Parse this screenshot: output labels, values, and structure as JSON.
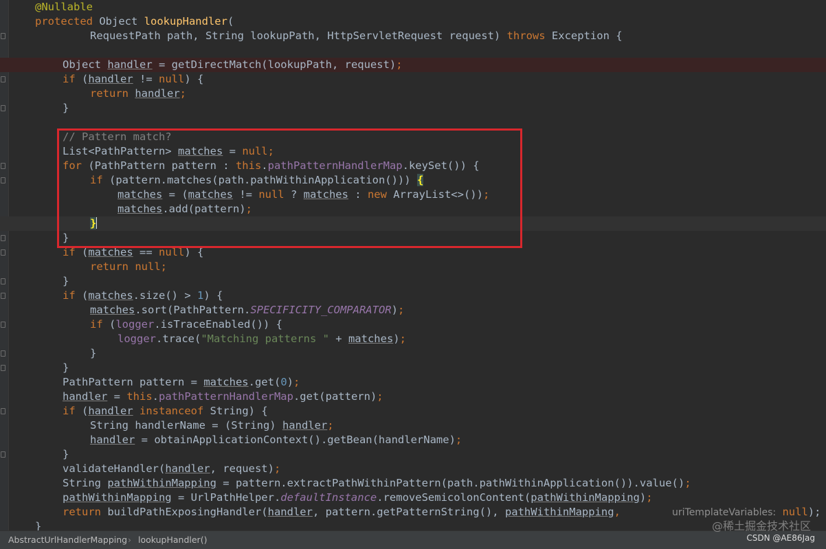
{
  "editor": {
    "lines": {
      "l0": {
        "a": "@Nullable"
      },
      "l1": {
        "kw": "protected",
        "a": " Object ",
        "fn": "lookupHandler",
        "b": "("
      },
      "l2": {
        "a": "RequestPath path, String lookupPath, HttpServletRequest request) ",
        "kw": "throws",
        "b": " Exception {"
      },
      "l4": {
        "a": "Object ",
        "u1": "handler",
        "b": " = getDirectMatch(lookupPath, request)",
        "c": ";"
      },
      "l5": {
        "kw": "if",
        "a": " (",
        "u1": "handler",
        "b": " != ",
        "kw2": "null",
        "c": ") {"
      },
      "l6": {
        "kw": "return",
        "a": " ",
        "u1": "handler",
        "b": ";"
      },
      "l7": {
        "a": "}"
      },
      "l9": {
        "cmt": "// Pattern match?"
      },
      "l10": {
        "a": "List<PathPattern> ",
        "u1": "matches",
        "b": " = ",
        "kw": "null",
        "c": ";"
      },
      "l11": {
        "kw": "for",
        "a": " (PathPattern pattern : ",
        "kw2": "this",
        "b": ".",
        "fld": "pathPatternHandlerMap",
        "c": ".keySet()) {"
      },
      "l12": {
        "kw": "if",
        "a": " (pattern.matches(path.pathWithinApplication())) ",
        "br": "{"
      },
      "l13": {
        "u1": "matches",
        "a": " = (",
        "u2": "matches",
        "b": " != ",
        "kw": "null",
        "c": " ? ",
        "u3": "matches",
        "d": " : ",
        "kw2": "new",
        "e": " ArrayList<>())",
        "f": ";"
      },
      "l14": {
        "u1": "matches",
        "a": ".add(pattern)",
        "b": ";"
      },
      "l15": {
        "br": "}"
      },
      "l16": {
        "a": "}"
      },
      "l17": {
        "kw": "if",
        "a": " (",
        "u1": "matches",
        "b": " == ",
        "kw2": "null",
        "c": ") {"
      },
      "l18": {
        "kw": "return",
        "a": " ",
        "kw2": "null",
        "b": ";"
      },
      "l19": {
        "a": "}"
      },
      "l20": {
        "kw": "if",
        "a": " (",
        "u1": "matches",
        "b": ".size() > ",
        "num": "1",
        "c": ") {"
      },
      "l21": {
        "u1": "matches",
        "a": ".sort(PathPattern.",
        "sf": "SPECIFICITY_COMPARATOR",
        "b": ")",
        "c": ";"
      },
      "l22": {
        "kw": "if",
        "a": " (",
        "fld": "logger",
        "b": ".isTraceEnabled()) {"
      },
      "l23": {
        "fld": "logger",
        "a": ".trace(",
        "str": "\"Matching patterns \"",
        "b": " + ",
        "u1": "matches",
        "c": ")",
        "d": ";"
      },
      "l24": {
        "a": "}"
      },
      "l25": {
        "a": "}"
      },
      "l26": {
        "a": "PathPattern pattern = ",
        "u1": "matches",
        "b": ".get(",
        "num": "0",
        "c": ")",
        "d": ";"
      },
      "l27": {
        "u1": "handler",
        "a": " = ",
        "kw": "this",
        "b": ".",
        "fld": "pathPatternHandlerMap",
        "c": ".get(pattern)",
        "d": ";"
      },
      "l28": {
        "kw": "if",
        "a": " (",
        "u1": "handler",
        "b": " ",
        "kw2": "instanceof",
        "c": " String) {"
      },
      "l29": {
        "a": "String handlerName = (String) ",
        "u1": "handler",
        "b": ";"
      },
      "l30": {
        "u1": "handler",
        "a": " = obtainApplicationContext().getBean(handlerName)",
        "b": ";"
      },
      "l31": {
        "a": "}"
      },
      "l32": {
        "a": "validateHandler(",
        "u1": "handler",
        "b": ", request)",
        "c": ";"
      },
      "l33": {
        "a": "String ",
        "u1": "pathWithinMapping",
        "b": " = pattern.extractPathWithinPattern(path.pathWithinApplication()).value()",
        "c": ";"
      },
      "l34": {
        "u1": "pathWithinMapping",
        "a": " = UrlPathHelper.",
        "sf": "defaultInstance",
        "b": ".removeSemicolonContent(",
        "u2": "pathWithinMapping",
        "c": ")",
        "d": ";"
      },
      "l35": {
        "kw": "return",
        "a": " buildPathExposingHandler(",
        "u1": "handler",
        "b": ", pattern.getPatternString(), ",
        "u2": "pathWithinMapping",
        "c": ",",
        "hint": "uriTemplateVariables:",
        "kw2": "null",
        "d": ");"
      },
      "l36": {
        "a": "}"
      }
    }
  },
  "breadcrumb": {
    "class_name": "AbstractUrlHandlerMapping",
    "method_name": "lookupHandler()"
  },
  "watermark": {
    "site": "@稀土掘金技术社区",
    "author": "CSDN @AE86Jag"
  },
  "colors": {
    "background": "#2b2b2b",
    "keyword": "#cc7832",
    "annotation": "#bbb529",
    "highlight_box": "#d8272d"
  }
}
